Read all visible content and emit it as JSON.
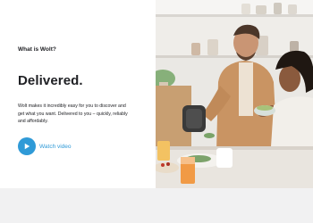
{
  "hero": {
    "eyebrow": "What is Wolt?",
    "headline": "Delivered.",
    "body": "Wolt makes it incredibly easy for you to discover and get what you want. Delivered to you – quickly, reliably and affordably.",
    "watch_label": "Watch video",
    "accent_color": "#2f9ad7"
  },
  "photo": {
    "icon": "people-breakfast-photo"
  }
}
